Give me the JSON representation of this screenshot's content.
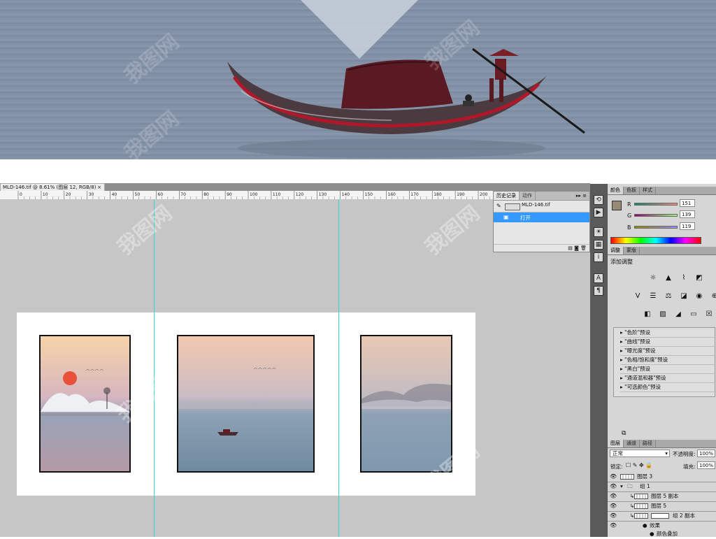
{
  "document_tab": {
    "title": "MLD-146.tif @ 8.61% (图层 12, RGB/8)",
    "close": "×"
  },
  "ruler": {
    "labels": [
      "0",
      "10",
      "20",
      "30",
      "40",
      "50",
      "60",
      "70",
      "80",
      "90",
      "100",
      "110",
      "120",
      "130",
      "140",
      "150",
      "160",
      "170",
      "180",
      "190",
      "200"
    ]
  },
  "history_panel": {
    "tabs": [
      "历史记录",
      "动作"
    ],
    "snapshot": "MLD-146.tif",
    "items": [
      "打开"
    ]
  },
  "color_panel": {
    "tabs": [
      "颜色",
      "色板",
      "样式"
    ],
    "r_label": "R",
    "g_label": "G",
    "b_label": "B",
    "r": "151",
    "g": "139",
    "b": "119",
    "foreground": "#978b77",
    "background": "#000000"
  },
  "adjustments_panel": {
    "tabs": [
      "调整",
      "蒙版"
    ],
    "heading": "添加调整",
    "presets": [
      "\"色阶\"预设",
      "\"曲线\"预设",
      "\"曝光度\"预设",
      "\"色相/饱和度\"预设",
      "\"黑白\"预设",
      "\"通道混和器\"预设",
      "\"可选颜色\"预设"
    ]
  },
  "layers_panel": {
    "tabs": [
      "图层",
      "通道",
      "路径"
    ],
    "blend_mode": "正常",
    "opacity_label": "不透明度:",
    "opacity": "100%",
    "lock_label": "锁定:",
    "fill_label": "填充:",
    "fill": "100%",
    "layers": [
      "图层 3",
      "组 1",
      "图层 5 副本",
      "图层 5",
      "组 2 副本",
      "效果",
      "颜色叠加"
    ]
  },
  "watermark": "我图网",
  "colors": {
    "guide": "#37d4d4",
    "selection": "#3399ff",
    "canvas_bg": "#c6c6c6"
  }
}
